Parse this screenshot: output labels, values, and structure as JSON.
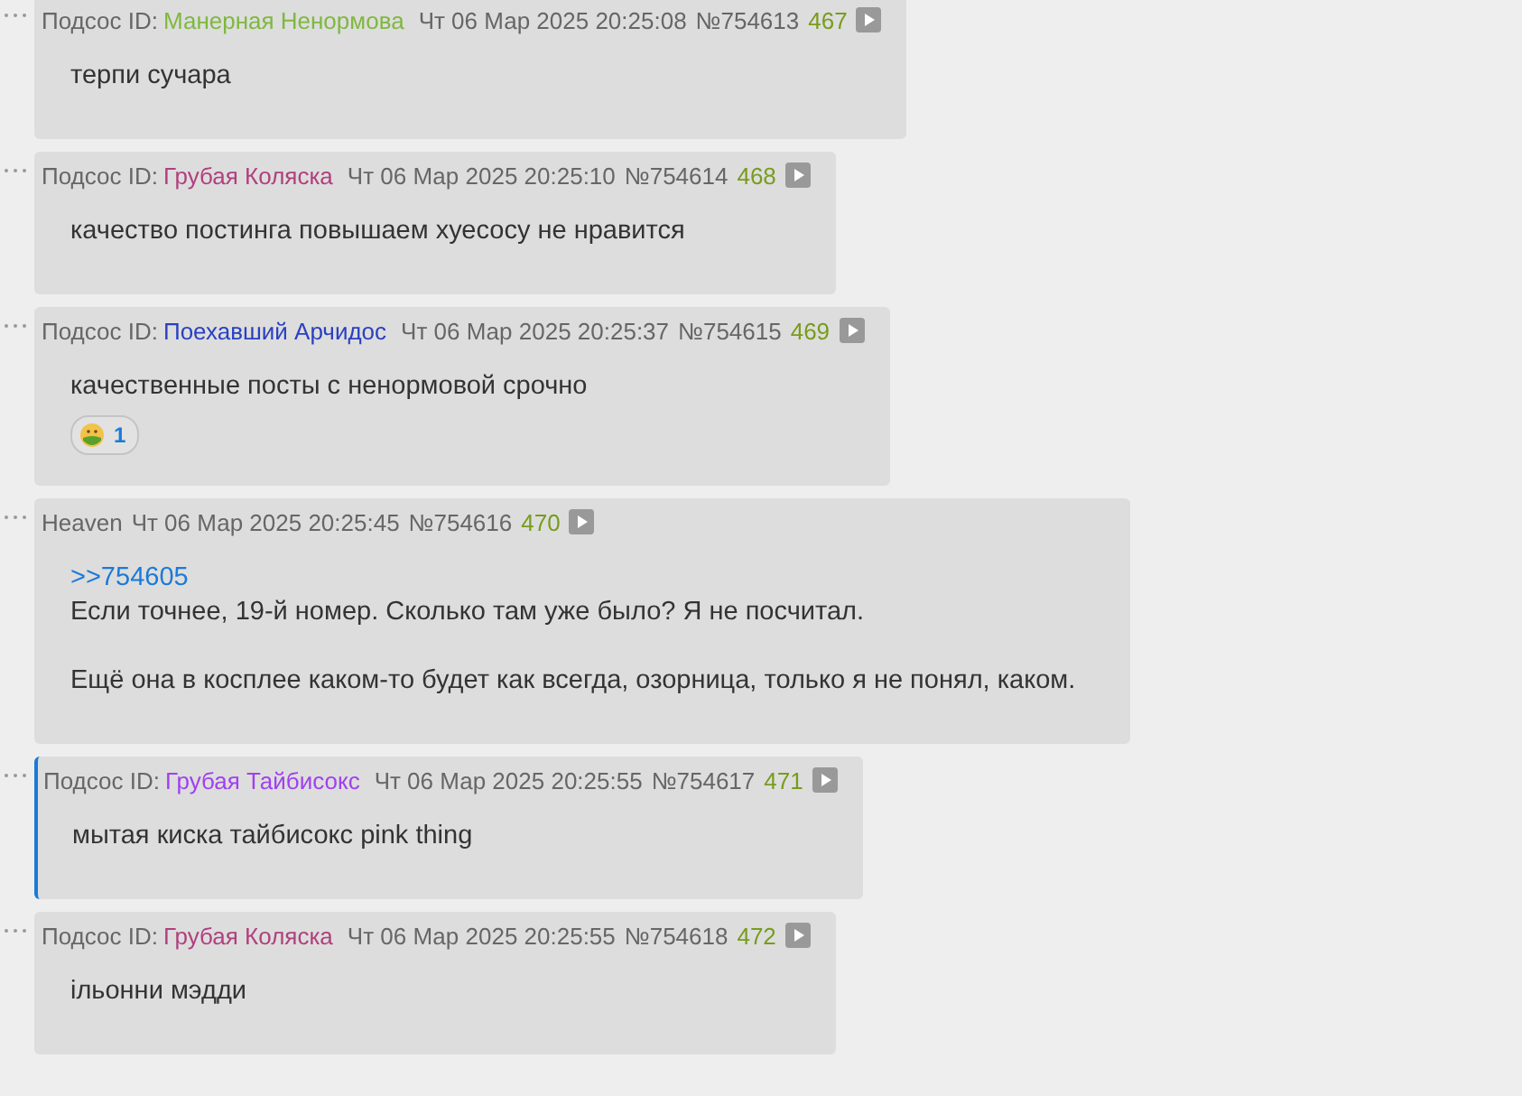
{
  "posts": [
    {
      "kind": "anon",
      "id_label": "Подсос ID:",
      "name": "Манерная Ненормова",
      "color": "#7fb83e",
      "date": "Чт 06 Мар 2025 20:25:08",
      "number": "№754613",
      "counter": "467",
      "highlighted": false,
      "paragraphs": [
        "терпи сучара"
      ]
    },
    {
      "kind": "anon",
      "id_label": "Подсос ID:",
      "name": "Грубая Коляска",
      "color": "#b0407e",
      "date": "Чт 06 Мар 2025 20:25:10",
      "number": "№754614",
      "counter": "468",
      "highlighted": false,
      "paragraphs": [
        "качество постинга повышаем хуесосу не нравится"
      ]
    },
    {
      "kind": "anon",
      "id_label": "Подсос ID:",
      "name": "Поехавший Арчидос",
      "color": "#2a40c0",
      "date": "Чт 06 Мар 2025 20:25:37",
      "number": "№754615",
      "counter": "469",
      "highlighted": false,
      "paragraphs": [
        "качественные посты с ненормовой срочно"
      ],
      "reactions": [
        {
          "count": "1"
        }
      ]
    },
    {
      "kind": "named",
      "name": "Heaven",
      "date": "Чт 06 Мар 2025 20:25:45",
      "number": "№754616",
      "counter": "470",
      "highlighted": false,
      "reply_link": ">>754605",
      "paragraphs": [
        "Если точнее, 19-й номер. Сколько там уже было? Я не посчитал.",
        "Ещё она в косплее каком-то будет как всегда, озорница, только я не понял, каком."
      ]
    },
    {
      "kind": "anon",
      "id_label": "Подсос ID:",
      "name": "Грубая Тайбисокс",
      "color": "#a040f0",
      "date": "Чт 06 Мар 2025 20:25:55",
      "number": "№754617",
      "counter": "471",
      "highlighted": true,
      "paragraphs": [
        "мытая киска тайбисокс pink thing"
      ]
    },
    {
      "kind": "anon",
      "id_label": "Подсос ID:",
      "name": "Грубая Коляска",
      "color": "#b0407e",
      "date": "Чт 06 Мар 2025 20:25:55",
      "number": "№754618",
      "counter": "472",
      "highlighted": false,
      "paragraphs": [
        "ільонни мэдди"
      ]
    }
  ]
}
